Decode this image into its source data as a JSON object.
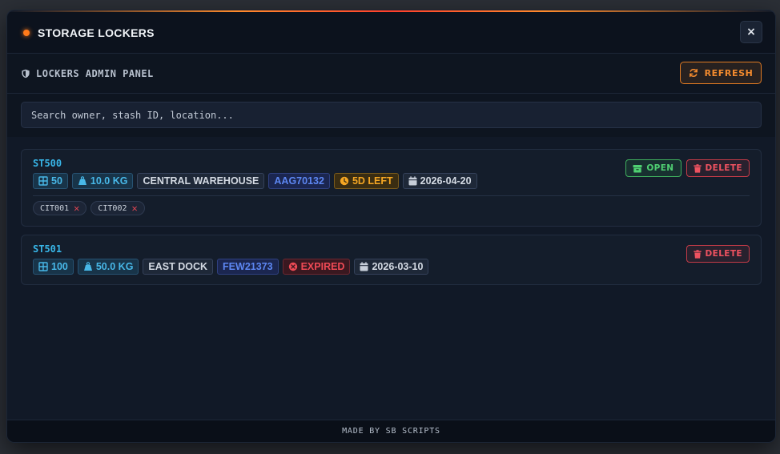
{
  "window": {
    "title": "STORAGE LOCKERS",
    "close_label": "×",
    "accent_color": "#ff7a1a"
  },
  "panel": {
    "title": "LOCKERS ADMIN PANEL",
    "refresh_label": "REFRESH"
  },
  "search": {
    "value": "",
    "placeholder": "Search owner, stash ID, location..."
  },
  "lockers": [
    {
      "id": "ST500",
      "slots": "50",
      "weight": "10.0 KG",
      "location": "CENTRAL WAREHOUSE",
      "owner": "AAG70132",
      "status": "5D LEFT",
      "date": "2026-04-20",
      "tags": [
        "CIT001",
        "CIT002"
      ],
      "open_label": "OPEN",
      "delete_label": "DELETE"
    },
    {
      "id": "ST501",
      "slots": "100",
      "weight": "50.0 KG",
      "location": "EAST DOCK",
      "owner": "FEW21373",
      "status": "EXPIRED",
      "date": "2026-03-10",
      "delete_label": "DELETE"
    }
  ],
  "footer": {
    "text": "MADE BY SB SCRIPTS"
  },
  "icons": {
    "title": "status-dot",
    "panel": "shield-icon",
    "refresh": "refresh-icon",
    "slots": "grid-icon",
    "weight": "weight-icon",
    "time_left": "clock-icon",
    "expired": "x-circle-icon",
    "date": "calendar-icon",
    "open": "box-icon",
    "delete": "trash-icon",
    "tag_remove": "x-icon"
  }
}
